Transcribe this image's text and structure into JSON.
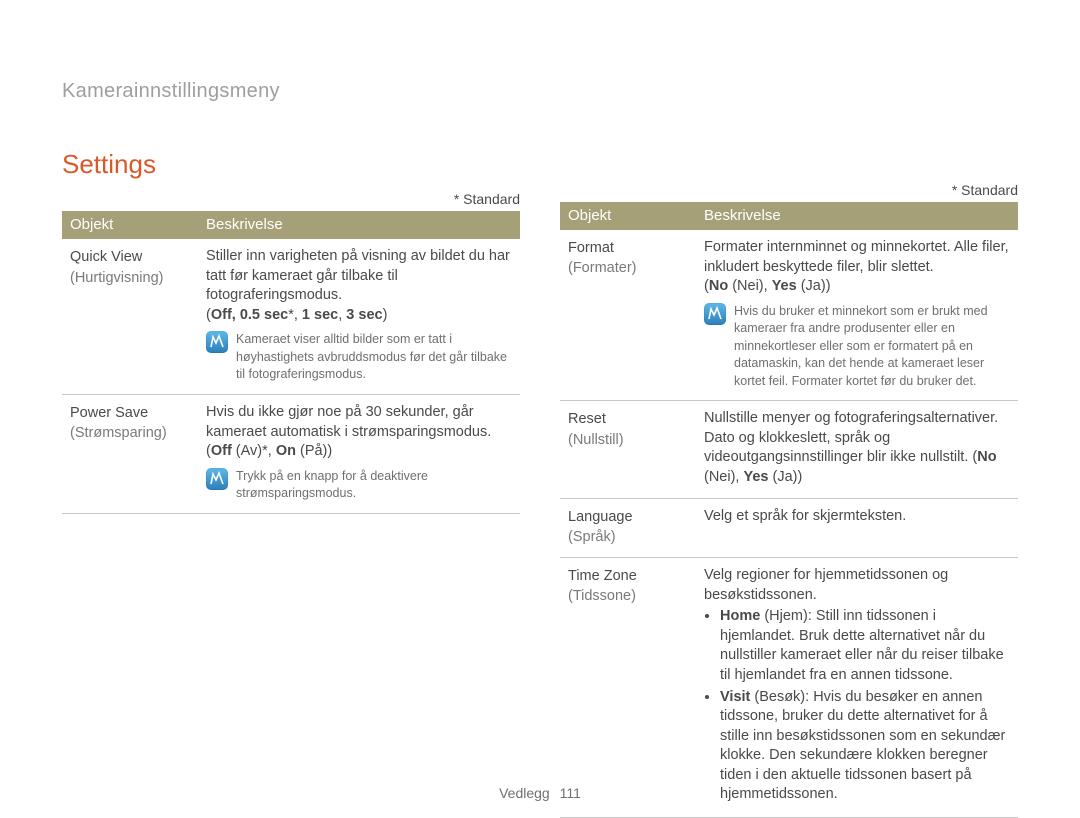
{
  "running_head": "Kamerainnstillingsmeny",
  "section_title": "Settings",
  "standard_note": "* Standard",
  "table_headers": {
    "objekt": "Objekt",
    "beskrivelse": "Beskrivelse"
  },
  "left": [
    {
      "obj_main": "Quick View",
      "obj_sub": "(Hurtigvisning)",
      "desc_intro": "Stiller inn varigheten på visning av bildet du har tatt før kameraet går tilbake til fotograferingsmodus.",
      "options_bold": "Off",
      "options_rest": ", 0.5 sec*, 1 sec, 3 sec",
      "note": "Kameraet viser alltid bilder som er tatt i høyhastighets avbruddsmodus før det går tilbake til fotograferingsmodus."
    },
    {
      "obj_main": "Power Save",
      "obj_sub": "(Strømsparing)",
      "desc_intro": "Hvis du ikke gjør noe på 30 sekunder, går kameraet automatisk i strømsparingsmodus.",
      "options_html": "(<b>Off</b> (Av)*, <b>On</b> (På))",
      "note": "Trykk på en knapp for å deaktivere strømsparingsmodus."
    }
  ],
  "right": [
    {
      "obj_main": "Format",
      "obj_sub": "(Formater)",
      "desc_intro": "Formater internminnet og minnekortet. Alle filer, inkludert beskyttede filer, blir slettet.",
      "options_html": "(<b>No</b> (Nei), <b>Yes</b> (Ja))",
      "note": "Hvis du bruker et minnekort som er brukt med kameraer fra andre produsenter eller en minnekortleser eller som er formatert på en datamaskin, kan det hende at kameraet leser kortet feil. Formater kortet før du bruker det."
    },
    {
      "obj_main": "Reset",
      "obj_sub": "(Nullstill)",
      "desc_html": "Nullstille menyer og fotograferingsalternativer. Dato og klokkeslett, språk og videoutgangsinnstillinger blir ikke nullstilt. (<b>No</b> (Nei), <b>Yes</b> (Ja))"
    },
    {
      "obj_main": "Language",
      "obj_sub": "(Språk)",
      "desc_html": "Velg et språk for skjermteksten."
    },
    {
      "obj_main": "Time Zone",
      "obj_sub": "(Tidssone)",
      "tz_intro": "Velg regioner for hjemmetidssonen og besøkstidssonen.",
      "tz_home": "<b>Home</b> (Hjem): Still inn tidssonen i hjemlandet. Bruk dette alternativet når du nullstiller kameraet eller når du reiser tilbake til hjemlandet fra en annen tidssone.",
      "tz_visit": "<b>Visit</b> (Besøk): Hvis du besøker en annen tidssone, bruker du dette alternativet for å stille inn besøkstidssonen som en sekundær klokke. Den sekundære klokken beregner tiden i den aktuelle tidssonen basert på hjemmetidssonen."
    }
  ],
  "footer": {
    "label": "Vedlegg",
    "page": "111"
  }
}
